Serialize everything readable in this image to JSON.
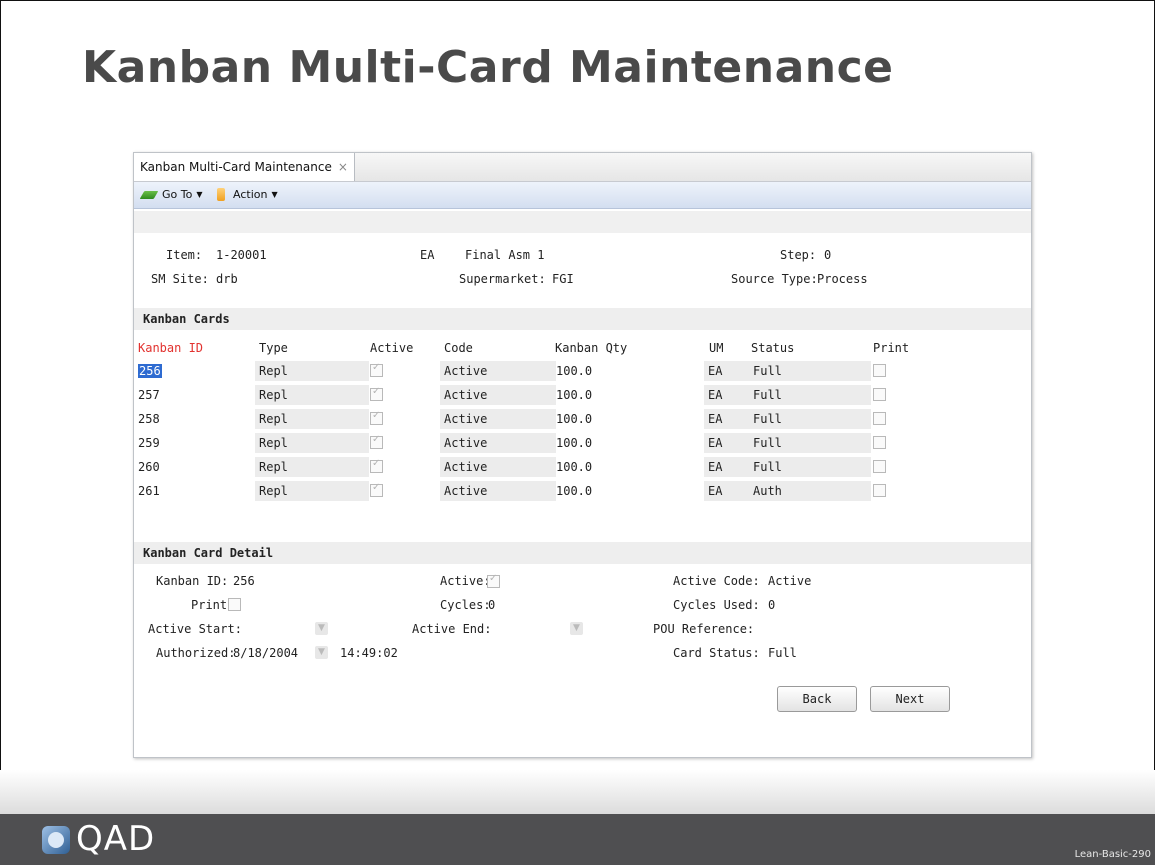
{
  "slide": {
    "title": "Kanban Multi-Card Maintenance",
    "logo_text": "QAD",
    "slide_code": "Lean-Basic-290"
  },
  "window": {
    "tab_label": "Kanban Multi-Card Maintenance",
    "tab_close": "×",
    "toolbar": {
      "goto_label": "Go To",
      "action_label": "Action",
      "dropdown_glyph": "▼"
    }
  },
  "header": {
    "item_label": "Item:",
    "item_value": "1-20001",
    "um_value": "EA",
    "description": "Final Asm 1",
    "step_label": "Step:",
    "step_value": "0",
    "site_label": "SM Site:",
    "site_value": "drb",
    "supermarket_label": "Supermarket:",
    "supermarket_value": "FGI",
    "source_type_label": "Source Type:",
    "source_type_value": "Process"
  },
  "cards": {
    "section_title": "Kanban Cards",
    "columns": [
      "Kanban ID",
      "Type",
      "Active",
      "Code",
      "Kanban Qty",
      "UM",
      "Status",
      "Print"
    ],
    "rows": [
      {
        "id": "256",
        "type": "Repl",
        "active": true,
        "code": "Active",
        "qty": "100.0",
        "um": "EA",
        "status": "Full",
        "print": false
      },
      {
        "id": "257",
        "type": "Repl",
        "active": true,
        "code": "Active",
        "qty": "100.0",
        "um": "EA",
        "status": "Full",
        "print": false
      },
      {
        "id": "258",
        "type": "Repl",
        "active": true,
        "code": "Active",
        "qty": "100.0",
        "um": "EA",
        "status": "Full",
        "print": false
      },
      {
        "id": "259",
        "type": "Repl",
        "active": true,
        "code": "Active",
        "qty": "100.0",
        "um": "EA",
        "status": "Full",
        "print": false
      },
      {
        "id": "260",
        "type": "Repl",
        "active": true,
        "code": "Active",
        "qty": "100.0",
        "um": "EA",
        "status": "Full",
        "print": false
      },
      {
        "id": "261",
        "type": "Repl",
        "active": true,
        "code": "Active",
        "qty": "100.0",
        "um": "EA",
        "status": "Auth",
        "print": false
      }
    ]
  },
  "detail": {
    "section_title": "Kanban Card Detail",
    "kanban_id_label": "Kanban ID:",
    "kanban_id_value": "256",
    "active_label": "Active:",
    "active_code_label": "Active Code:",
    "active_code_value": "Active",
    "print_label": "Print:",
    "cycles_label": "Cycles:",
    "cycles_value": "0",
    "cycles_used_label": "Cycles Used:",
    "cycles_used_value": "0",
    "active_start_label": "Active Start:",
    "active_end_label": "Active End:",
    "pou_label": "POU Reference:",
    "authorized_label": "Authorized:",
    "authorized_date": "8/18/2004",
    "authorized_time": "14:49:02",
    "card_status_label": "Card Status:",
    "card_status_value": "Full"
  },
  "buttons": {
    "back": "Back",
    "next": "Next"
  }
}
